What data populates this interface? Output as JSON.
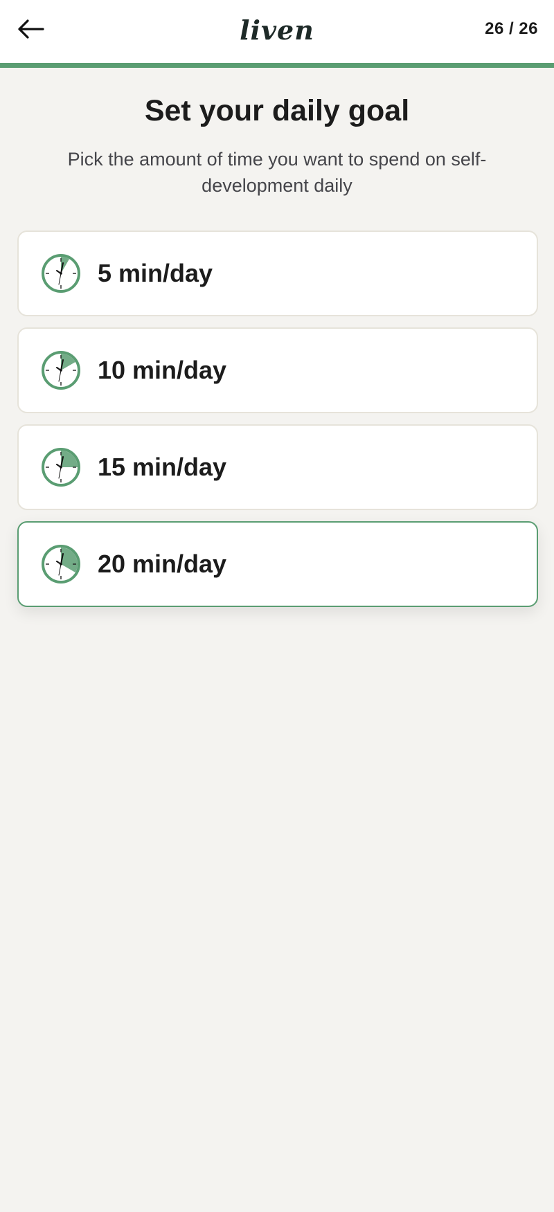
{
  "header": {
    "back_icon": "arrow-left-icon",
    "logo_text": "liven",
    "counter": "26 / 26",
    "progress": 1.0,
    "accent_color": "#5a9d72"
  },
  "main": {
    "title": "Set your daily goal",
    "subtitle": "Pick the amount of time you want to spend on self-development daily"
  },
  "options": [
    {
      "label": "5 min/day",
      "icon": "clock-icon",
      "minutes": 5,
      "selected": false
    },
    {
      "label": "10 min/day",
      "icon": "clock-icon",
      "minutes": 10,
      "selected": false
    },
    {
      "label": "15 min/day",
      "icon": "clock-icon",
      "minutes": 15,
      "selected": false
    },
    {
      "label": "20 min/day",
      "icon": "clock-icon",
      "minutes": 20,
      "selected": true
    }
  ]
}
